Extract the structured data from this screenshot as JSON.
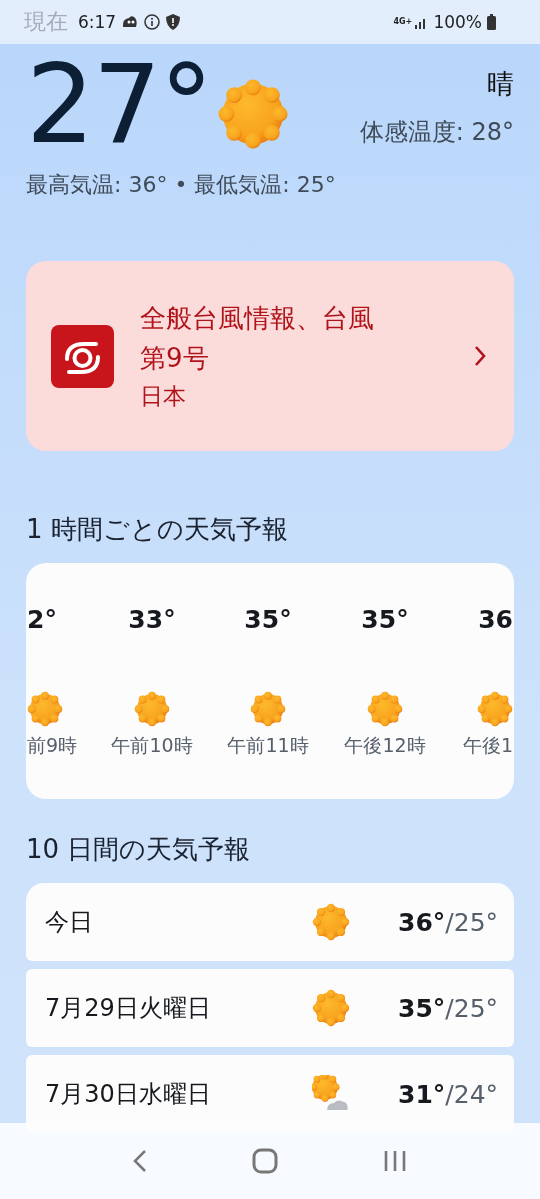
{
  "status_bar": {
    "time": "6:17",
    "network": "4G+",
    "battery": "100%",
    "ghost_title": "現在"
  },
  "current": {
    "temperature": "27°",
    "kind": "sunny",
    "condition": "晴",
    "feels_like": "体感温度: 28°",
    "high_low": "最高気温: 36° • 最低気温: 25°"
  },
  "alert": {
    "title": "全般台風情報、台風第9号",
    "region": "日本"
  },
  "hourly": {
    "heading": "1 時間ごとの天気予報",
    "items": [
      {
        "temperature": "2°",
        "kind": "sunny",
        "time": "前9時"
      },
      {
        "temperature": "33°",
        "kind": "sunny",
        "time": "午前10時"
      },
      {
        "temperature": "35°",
        "kind": "sunny",
        "time": "午前11時"
      },
      {
        "temperature": "35°",
        "kind": "sunny",
        "time": "午後12時"
      },
      {
        "temperature": "36",
        "kind": "sunny",
        "time": "午後1"
      }
    ]
  },
  "daily": {
    "heading": "10 日間の天気予報",
    "days": [
      {
        "day": "今日",
        "kind": "sunny",
        "high": "36°",
        "low": "/25°"
      },
      {
        "day": "7月29日火曜日",
        "kind": "sunny",
        "high": "35°",
        "low": "/25°"
      },
      {
        "day": "7月30日水曜日",
        "kind": "partly_cloudy",
        "high": "31°",
        "low": "/24°"
      }
    ]
  }
}
